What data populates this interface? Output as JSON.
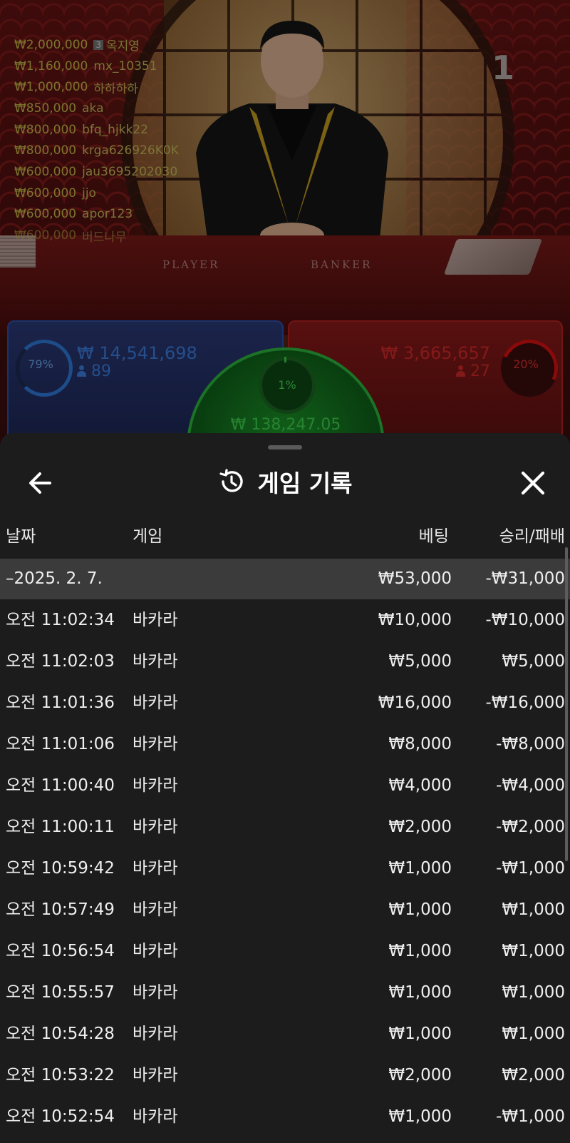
{
  "game_view": {
    "round_number": "1",
    "table_labels": {
      "player": "PLAYER",
      "banker": "BANKER"
    },
    "leaderboard": [
      {
        "amount": "₩2,000,000",
        "badge": "3",
        "name": "옥지영"
      },
      {
        "amount": "₩1,160,000",
        "badge": "",
        "name": "mx_10351"
      },
      {
        "amount": "₩1,000,000",
        "badge": "",
        "name": "하하하하"
      },
      {
        "amount": "₩850,000",
        "badge": "",
        "name": "aka"
      },
      {
        "amount": "₩800,000",
        "badge": "",
        "name": "bfq_hjkk22"
      },
      {
        "amount": "₩800,000",
        "badge": "",
        "name": "krga626926K0K"
      },
      {
        "amount": "₩600,000",
        "badge": "",
        "name": "jau3695202030"
      },
      {
        "amount": "₩600,000",
        "badge": "",
        "name": "jjo"
      },
      {
        "amount": "₩600,000",
        "badge": "",
        "name": "apor123"
      },
      {
        "amount": "₩600,000",
        "badge": "",
        "name": "버드나무"
      }
    ],
    "player": {
      "percent": "79%",
      "total": "₩ 14,541,698",
      "bettors": "89",
      "color": "#3d7fe0"
    },
    "banker": {
      "percent": "20%",
      "total": "₩ 3,665,657",
      "bettors": "27",
      "color": "#d42a2a"
    },
    "tie": {
      "percent": "1%",
      "total": "₩ 138,247.05",
      "color": "#3ed44f"
    }
  },
  "history_sheet": {
    "title": "게임 기록",
    "icons": {
      "back": "arrow-left-icon",
      "title": "history-icon",
      "close": "close-icon"
    },
    "columns": {
      "date": "날짜",
      "game": "게임",
      "bet": "베팅",
      "result": "승리/패배"
    },
    "group": {
      "date": "–2025. 2. 7.",
      "bet": "₩53,000",
      "result": "-₩31,000"
    },
    "rows": [
      {
        "time": "오전 11:02:34",
        "game": "바카라",
        "bet": "₩10,000",
        "result": "-₩10,000"
      },
      {
        "time": "오전 11:02:03",
        "game": "바카라",
        "bet": "₩5,000",
        "result": "₩5,000"
      },
      {
        "time": "오전 11:01:36",
        "game": "바카라",
        "bet": "₩16,000",
        "result": "-₩16,000"
      },
      {
        "time": "오전 11:01:06",
        "game": "바카라",
        "bet": "₩8,000",
        "result": "-₩8,000"
      },
      {
        "time": "오전 11:00:40",
        "game": "바카라",
        "bet": "₩4,000",
        "result": "-₩4,000"
      },
      {
        "time": "오전 11:00:11",
        "game": "바카라",
        "bet": "₩2,000",
        "result": "-₩2,000"
      },
      {
        "time": "오전 10:59:42",
        "game": "바카라",
        "bet": "₩1,000",
        "result": "-₩1,000"
      },
      {
        "time": "오전 10:57:49",
        "game": "바카라",
        "bet": "₩1,000",
        "result": "₩1,000"
      },
      {
        "time": "오전 10:56:54",
        "game": "바카라",
        "bet": "₩1,000",
        "result": "₩1,000"
      },
      {
        "time": "오전 10:55:57",
        "game": "바카라",
        "bet": "₩1,000",
        "result": "₩1,000"
      },
      {
        "time": "오전 10:54:28",
        "game": "바카라",
        "bet": "₩1,000",
        "result": "₩1,000"
      },
      {
        "time": "오전 10:53:22",
        "game": "바카라",
        "bet": "₩2,000",
        "result": "₩2,000"
      },
      {
        "time": "오전 10:52:54",
        "game": "바카라",
        "bet": "₩1,000",
        "result": "-₩1,000"
      }
    ]
  }
}
